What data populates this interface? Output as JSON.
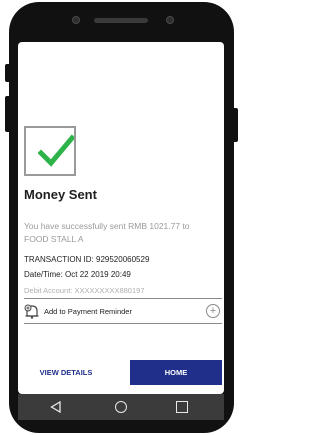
{
  "screen": {
    "title": "Money Sent",
    "message_prefix": "You have successfully sent  RMB 1021.77  to",
    "merchant": "FOOD STALL A",
    "transaction_id": "TRANSACTION ID:  929520060529",
    "date_time": "Date/Time:  Oct 22 2019 20:49",
    "debit_account": "Debit Account: XXXXXXXXX880197",
    "reminder_label": "Add to Payment Reminder",
    "add_symbol": "+"
  },
  "actions": {
    "view_details": "VIEW DETAILS",
    "home": "HOME"
  },
  "colors": {
    "success_check": "#2db34a",
    "primary": "#1f2f8a",
    "muted_text": "#9a9a9a"
  },
  "icons": {
    "success": "check-icon",
    "reminder": "bell-icon",
    "add": "plus-icon",
    "nav_back": "back-triangle-icon",
    "nav_home": "home-circle-icon",
    "nav_recent": "recent-square-icon"
  }
}
